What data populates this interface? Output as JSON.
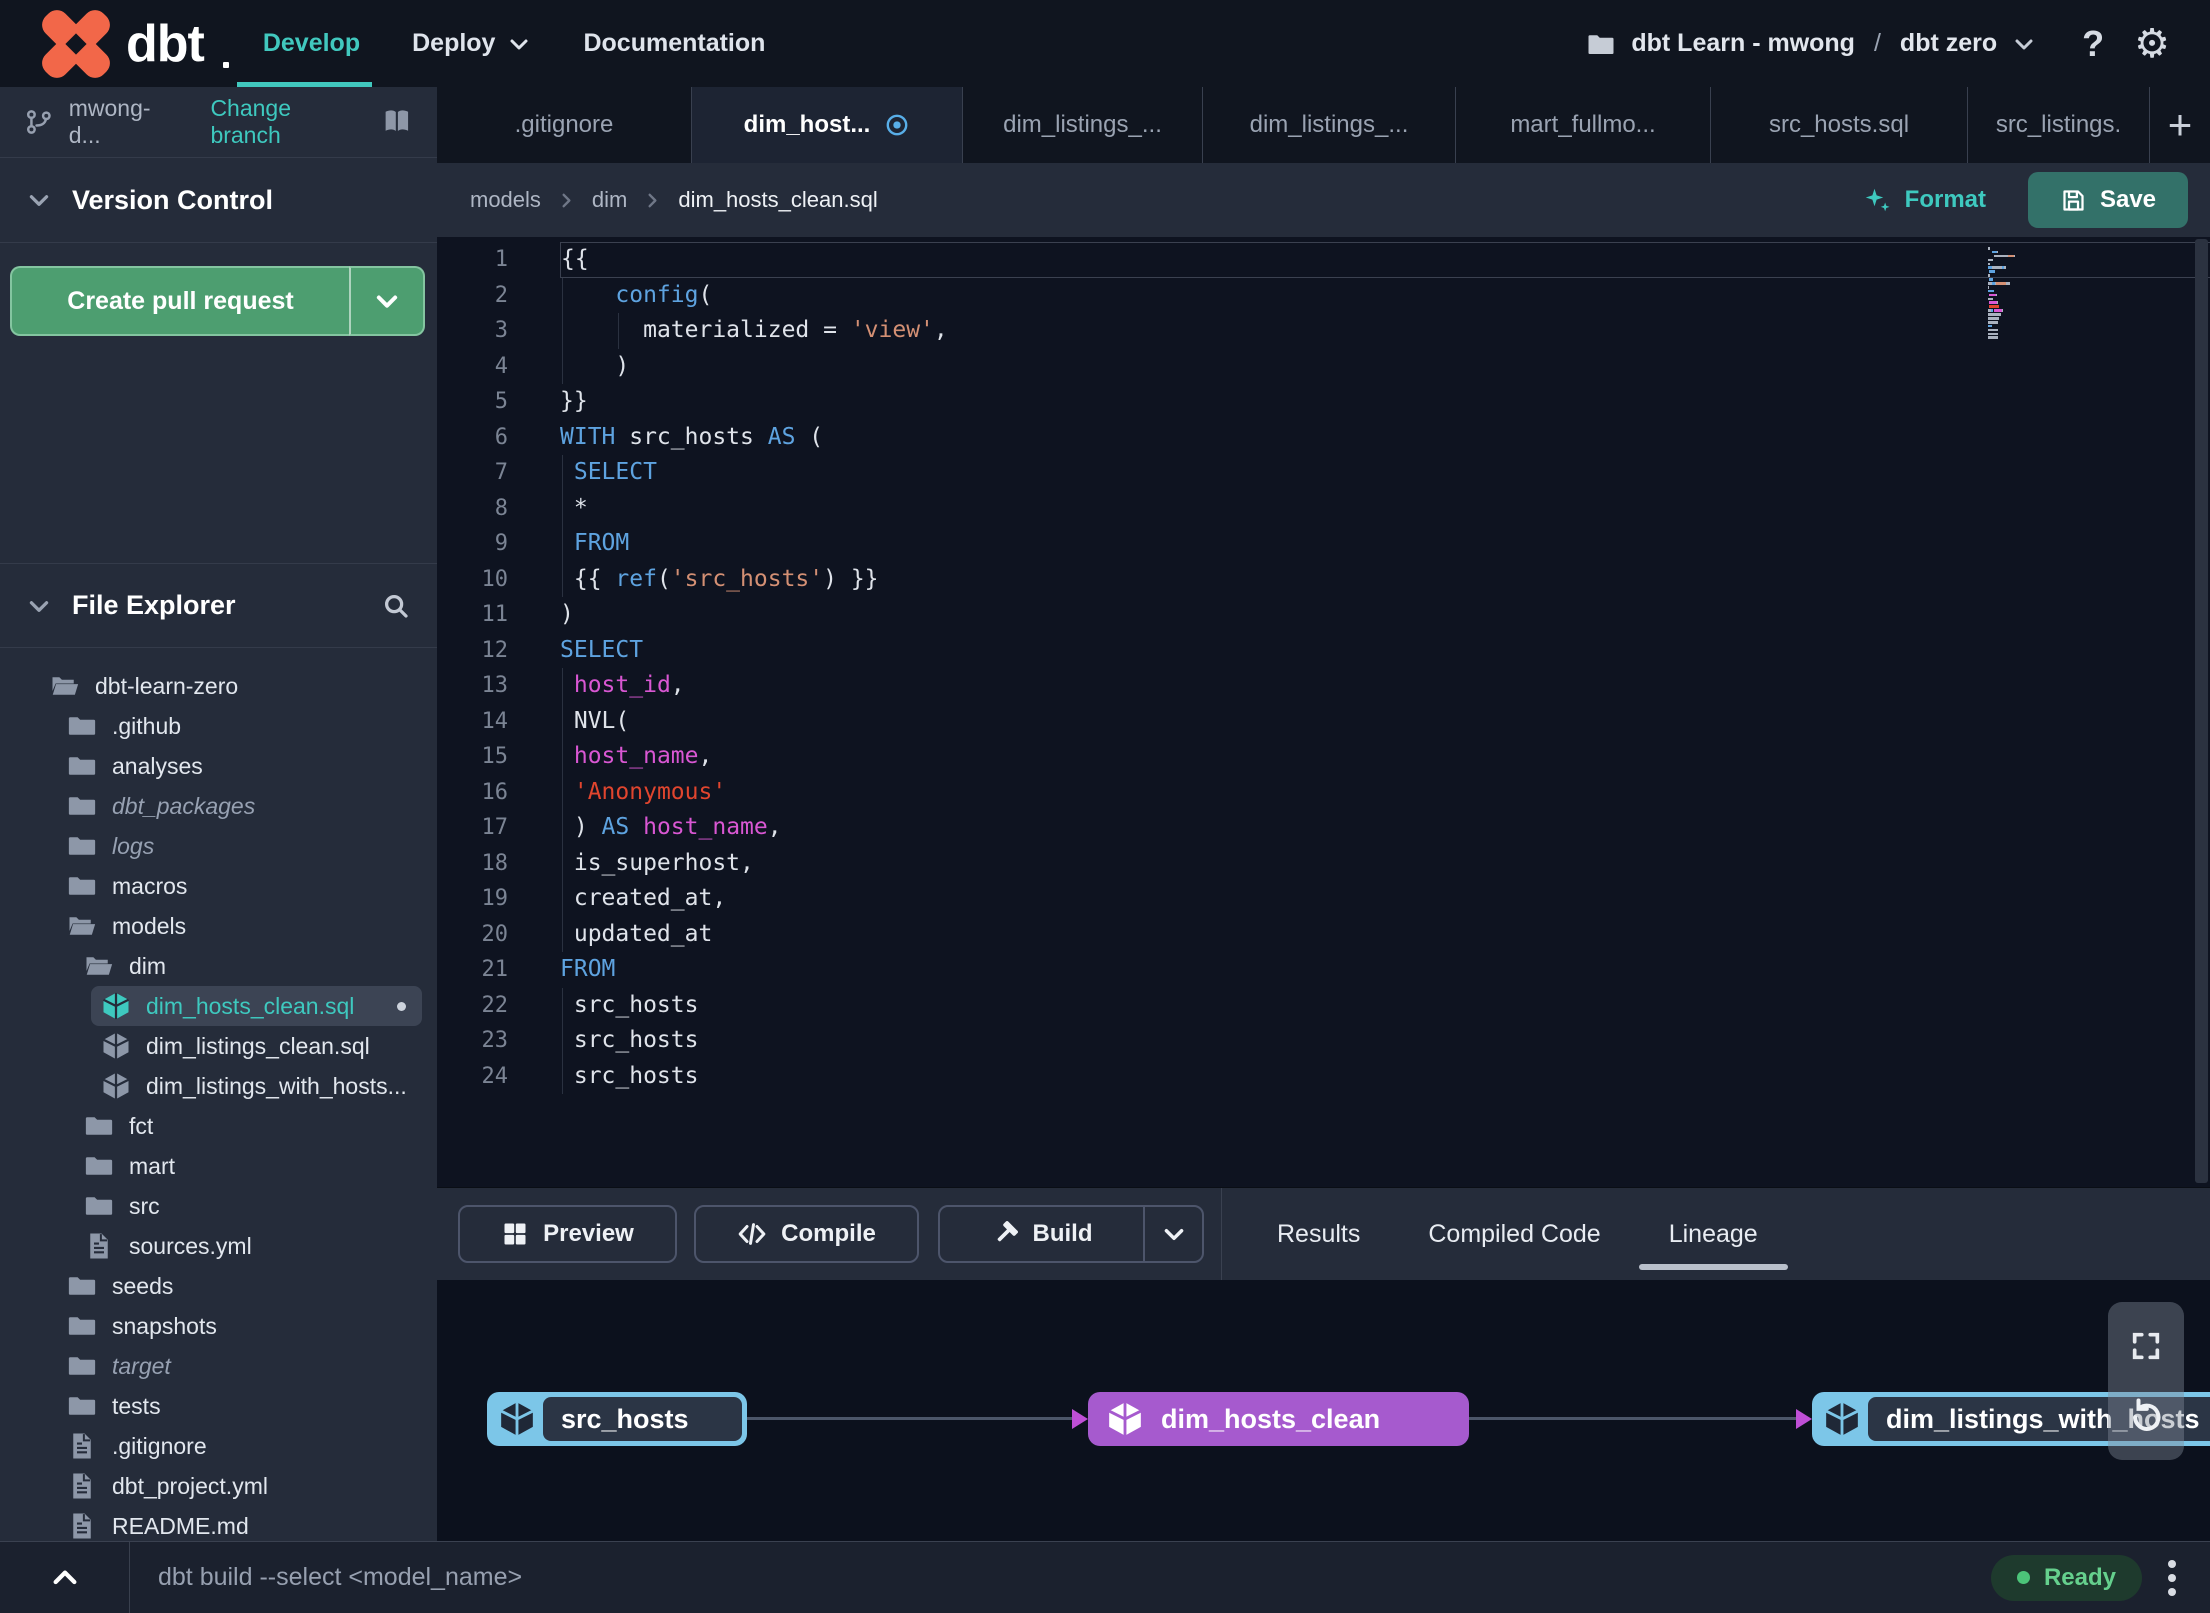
{
  "header": {
    "logo_text": "dbt",
    "nav": [
      {
        "label": "Develop",
        "active": true
      },
      {
        "label": "Deploy",
        "active": false
      },
      {
        "label": "Documentation",
        "active": false
      }
    ],
    "project": {
      "account": "dbt Learn - mwong",
      "separator": "/",
      "name": "dbt zero"
    },
    "help_icon": "?",
    "settings_icon": "⚙"
  },
  "sidebar": {
    "branch": {
      "name": "mwong-d...",
      "action": "Change branch"
    },
    "version_control": {
      "title": "Version Control",
      "button_label": "Create pull request"
    },
    "file_explorer": {
      "title": "File Explorer",
      "tree": [
        {
          "label": "dbt-learn-zero",
          "type": "folder-open",
          "depth": 0
        },
        {
          "label": ".github",
          "type": "folder",
          "depth": 1
        },
        {
          "label": "analyses",
          "type": "folder",
          "depth": 1
        },
        {
          "label": "dbt_packages",
          "type": "folder",
          "depth": 1,
          "italic": true
        },
        {
          "label": "logs",
          "type": "folder",
          "depth": 1,
          "italic": true
        },
        {
          "label": "macros",
          "type": "folder",
          "depth": 1
        },
        {
          "label": "models",
          "type": "folder-open",
          "depth": 1
        },
        {
          "label": "dim",
          "type": "folder-open",
          "depth": 2
        },
        {
          "label": "dim_hosts_clean.sql",
          "type": "model",
          "depth": 3,
          "selected": true,
          "modified": true
        },
        {
          "label": "dim_listings_clean.sql",
          "type": "model",
          "depth": 3
        },
        {
          "label": "dim_listings_with_hosts...",
          "type": "model",
          "depth": 3
        },
        {
          "label": "fct",
          "type": "folder",
          "depth": 2
        },
        {
          "label": "mart",
          "type": "folder",
          "depth": 2
        },
        {
          "label": "src",
          "type": "folder",
          "depth": 2
        },
        {
          "label": "sources.yml",
          "type": "file",
          "depth": 2
        },
        {
          "label": "seeds",
          "type": "folder",
          "depth": 1
        },
        {
          "label": "snapshots",
          "type": "folder",
          "depth": 1
        },
        {
          "label": "target",
          "type": "folder",
          "depth": 1,
          "italic": true
        },
        {
          "label": "tests",
          "type": "folder",
          "depth": 1
        },
        {
          "label": ".gitignore",
          "type": "file",
          "depth": 1
        },
        {
          "label": "dbt_project.yml",
          "type": "file",
          "depth": 1
        },
        {
          "label": "README.md",
          "type": "file",
          "depth": 1
        }
      ]
    }
  },
  "editor": {
    "tabs": [
      {
        "label": ".gitignore",
        "active": false,
        "unsaved": false
      },
      {
        "label": "dim_host...",
        "active": true,
        "unsaved": true
      },
      {
        "label": "dim_listings_...",
        "active": false,
        "unsaved": false
      },
      {
        "label": "dim_listings_...",
        "active": false,
        "unsaved": false
      },
      {
        "label": "mart_fullmo...",
        "active": false,
        "unsaved": false
      },
      {
        "label": "src_hosts.sql",
        "active": false,
        "unsaved": false
      },
      {
        "label": "src_listings.",
        "active": false,
        "unsaved": false
      }
    ],
    "new_tab_label": "+",
    "breadcrumb": [
      "models",
      "dim",
      "dim_hosts_clean.sql"
    ],
    "format_label": "Format",
    "save_label": "Save",
    "code_lines": [
      [
        [
          "{{",
          "p"
        ]
      ],
      [
        [
          "    ",
          "p"
        ],
        [
          "config",
          "k"
        ],
        [
          "(",
          "p"
        ]
      ],
      [
        [
          "      ",
          "p"
        ],
        [
          "materialized",
          "p"
        ],
        [
          " = ",
          "p"
        ],
        [
          "'view'",
          "s"
        ],
        [
          ",",
          "p"
        ]
      ],
      [
        [
          "    )",
          "p"
        ]
      ],
      [
        [
          "}}",
          "p"
        ]
      ],
      [
        [
          "WITH",
          "k"
        ],
        [
          " src_hosts ",
          "p"
        ],
        [
          "AS",
          "k"
        ],
        [
          " (",
          "p"
        ]
      ],
      [
        [
          " ",
          "p"
        ],
        [
          "SELECT",
          "k"
        ]
      ],
      [
        [
          " *",
          "p"
        ]
      ],
      [
        [
          " ",
          "p"
        ],
        [
          "FROM",
          "k"
        ]
      ],
      [
        [
          " {{ ",
          "p"
        ],
        [
          "ref",
          "k"
        ],
        [
          "(",
          "p"
        ],
        [
          "'src_hosts'",
          "s"
        ],
        [
          ") }}",
          "p"
        ]
      ],
      [
        [
          ")",
          "p"
        ]
      ],
      [
        [
          "SELECT",
          "k"
        ]
      ],
      [
        [
          " ",
          "p"
        ],
        [
          "host_id",
          "f"
        ],
        [
          ",",
          "p"
        ]
      ],
      [
        [
          " NVL(",
          "p"
        ]
      ],
      [
        [
          " ",
          "p"
        ],
        [
          "host_name",
          "f"
        ],
        [
          ",",
          "p"
        ]
      ],
      [
        [
          " ",
          "p"
        ],
        [
          "'Anonymous'",
          "r"
        ]
      ],
      [
        [
          " ) ",
          "p"
        ],
        [
          "AS",
          "k"
        ],
        [
          " ",
          "p"
        ],
        [
          "host_name",
          "f"
        ],
        [
          ",",
          "p"
        ]
      ],
      [
        [
          " is_superhost,",
          "p"
        ]
      ],
      [
        [
          " created_at,",
          "p"
        ]
      ],
      [
        [
          " updated_at",
          "p"
        ]
      ],
      [
        [
          "FROM",
          "k"
        ]
      ],
      [
        [
          " src_hosts",
          "p"
        ]
      ],
      [
        [
          " src_hosts",
          "p"
        ]
      ],
      [
        [
          " src_hosts",
          "p"
        ]
      ]
    ]
  },
  "panel": {
    "preview_label": "Preview",
    "compile_label": "Compile",
    "build_label": "Build",
    "tabs": [
      {
        "label": "Results",
        "active": false
      },
      {
        "label": "Compiled Code",
        "active": false
      },
      {
        "label": "Lineage",
        "active": true
      }
    ]
  },
  "lineage": {
    "nodes": [
      {
        "label": "src_hosts",
        "color": "blue"
      },
      {
        "label": "dim_hosts_clean",
        "color": "purple"
      },
      {
        "label": "dim_listings_with_hosts",
        "color": "blue"
      }
    ],
    "edges": [
      {
        "from": 0,
        "to": 1
      },
      {
        "from": 1,
        "to": 2
      }
    ]
  },
  "footer": {
    "command": "dbt build --select <model_name>",
    "status": "Ready"
  }
}
